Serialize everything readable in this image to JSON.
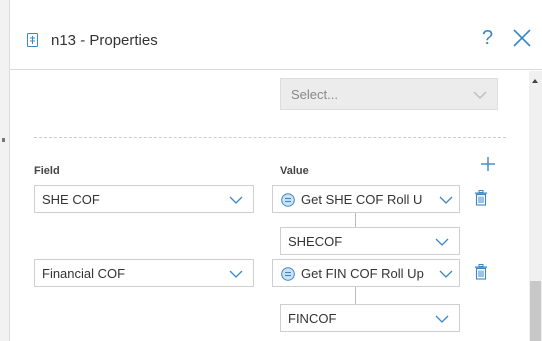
{
  "dialog": {
    "title": "n13 - Properties",
    "help_label": "?"
  },
  "top_select": {
    "value": "Select..."
  },
  "columns": {
    "field": "Field",
    "value": "Value"
  },
  "rows": [
    {
      "field": "SHE COF",
      "value": "Get SHE COF Roll U",
      "output": "SHECOF"
    },
    {
      "field": "Financial COF",
      "value": "Get FIN COF Roll Up",
      "output": "FINCOF"
    }
  ],
  "colors": {
    "accent": "#3a87c8",
    "border": "#cfcfcf",
    "disabled_bg": "#ececec"
  },
  "icons": {
    "document": "document-icon",
    "help": "help-icon",
    "close": "close-icon",
    "add": "plus-icon",
    "link": "link-circle-icon",
    "delete": "trash-icon",
    "dropdown": "chevron-down-icon"
  }
}
